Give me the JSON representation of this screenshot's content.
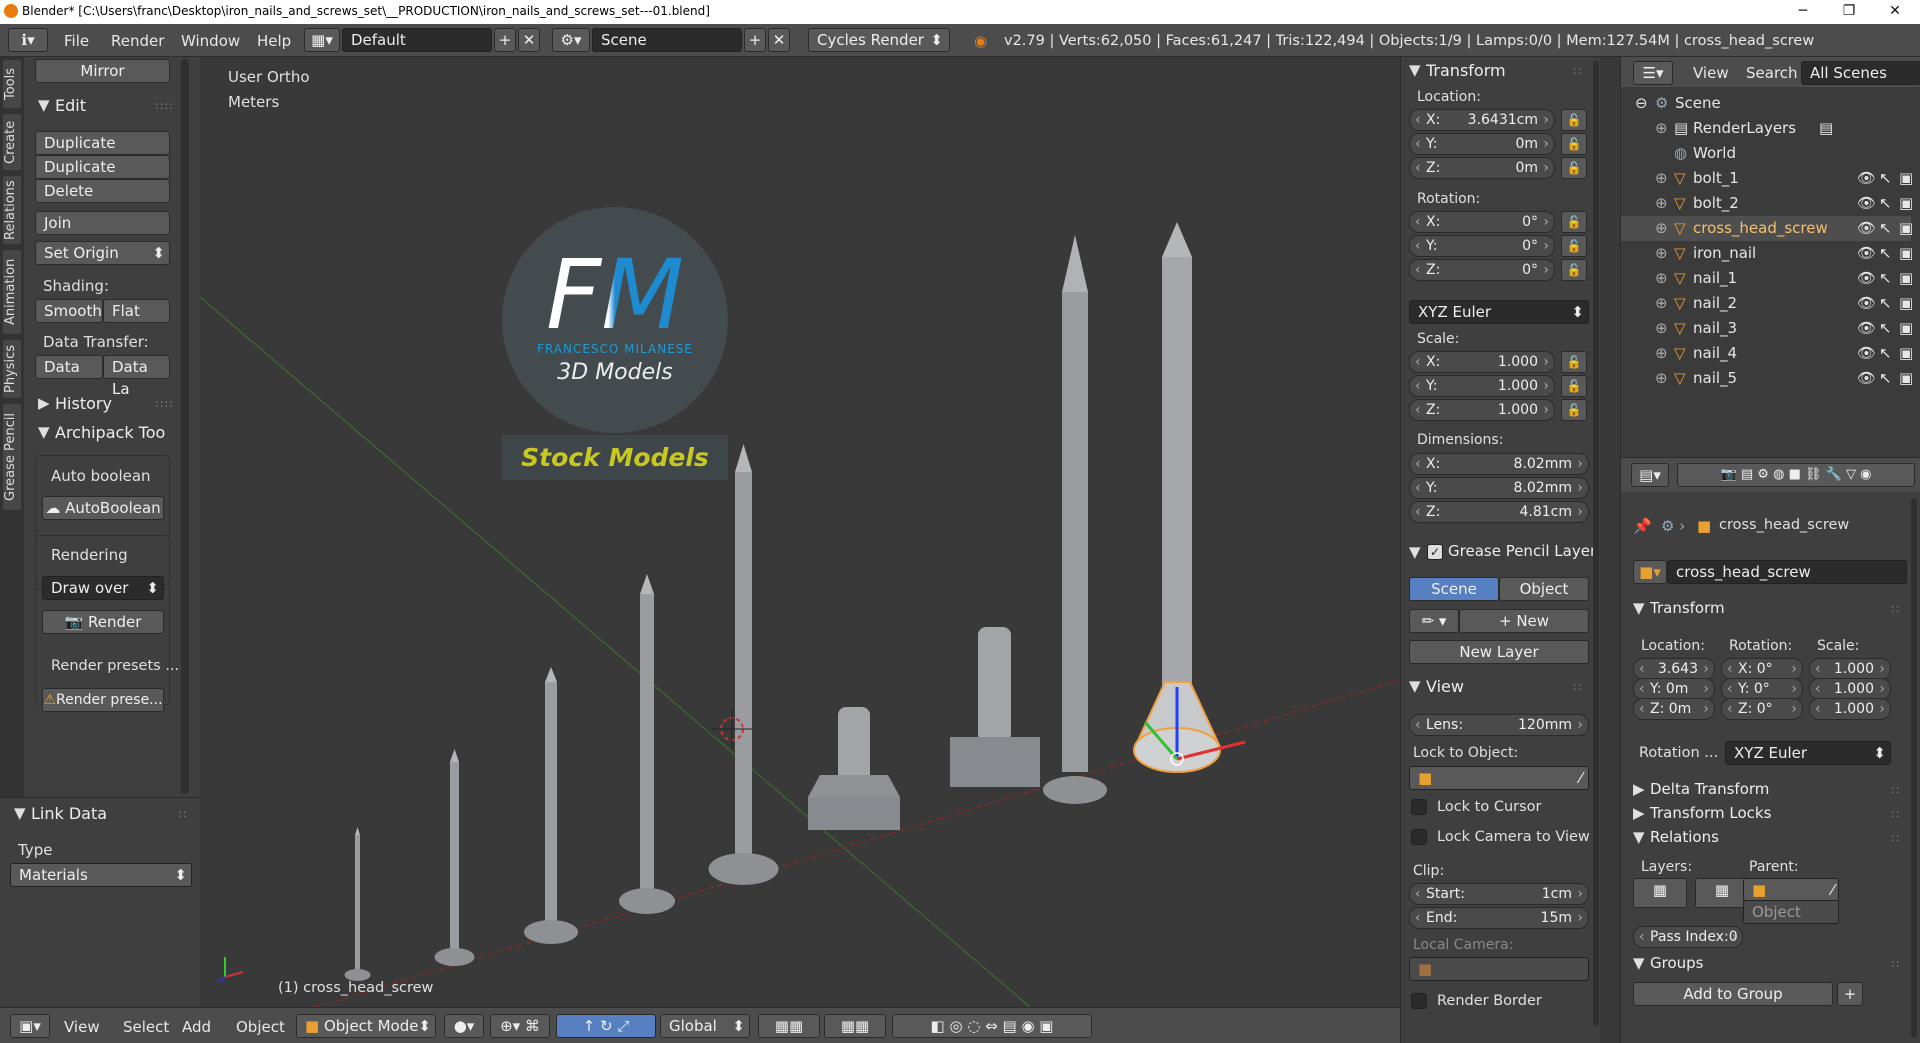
{
  "window": {
    "title": "Blender* [C:\\Users\\franc\\Desktop\\iron_nails_and_screws_set\\__PRODUCTION\\iron_nails_and_screws_set---01.blend]",
    "min": "─",
    "max": "❐",
    "close": "✕"
  },
  "topbar": {
    "menus": [
      "File",
      "Render",
      "Window",
      "Help"
    ],
    "layout": "Default",
    "scene": "Scene",
    "engine": "Cycles Render",
    "stats": "v2.79 | Verts:62,050 | Faces:61,247 | Tris:122,494 | Objects:1/9 | Lamps:0/0 | Mem:127.54M | cross_head_screw"
  },
  "tools": {
    "tabs": [
      "Tools",
      "Create",
      "Relations",
      "Animation",
      "Physics",
      "Grease Pencil"
    ],
    "mirror": "Mirror",
    "edit_title": "Edit",
    "duplicate": "Duplicate",
    "duplicate_linked": "Duplicate Linked",
    "delete": "Delete",
    "join": "Join",
    "set_origin": "Set Origin",
    "shading": "Shading:",
    "smooth": "Smooth",
    "flat": "Flat",
    "data_transfer": "Data Transfer:",
    "data": "Data",
    "data_la": "Data La",
    "history": "History",
    "archipack": "Archipack Too",
    "auto_boolean_title": "Auto boolean",
    "auto_boolean": "AutoBoolean",
    "rendering": "Rendering",
    "draw_over": "Draw over",
    "render": "Render",
    "render_presets": "Render presets ...",
    "render_prese": "Render prese..."
  },
  "link_data": {
    "title": "Link Data",
    "type_label": "Type",
    "type_value": "Materials"
  },
  "viewport": {
    "view": "User Ortho",
    "units": "Meters",
    "object_label": "(1) cross_head_screw",
    "logo_letters": "FM",
    "logo_name": "FRANCESCO MILANESE",
    "logo_sub": "3D Models",
    "stock": "Stock Models"
  },
  "viewport_header": {
    "view": "View",
    "select": "Select",
    "add": "Add",
    "object": "Object",
    "mode": "Object Mode",
    "orientation": "Global"
  },
  "properties": {
    "transform": "Transform",
    "location": "Location:",
    "loc": [
      {
        "k": "X:",
        "v": "3.6431cm"
      },
      {
        "k": "Y:",
        "v": "0m"
      },
      {
        "k": "Z:",
        "v": "0m"
      }
    ],
    "rotation": "Rotation:",
    "rot": [
      {
        "k": "X:",
        "v": "0°"
      },
      {
        "k": "Y:",
        "v": "0°"
      },
      {
        "k": "Z:",
        "v": "0°"
      }
    ],
    "euler": "XYZ Euler",
    "scale": "Scale:",
    "scl": [
      {
        "k": "X:",
        "v": "1.000"
      },
      {
        "k": "Y:",
        "v": "1.000"
      },
      {
        "k": "Z:",
        "v": "1.000"
      }
    ],
    "dimensions": "Dimensions:",
    "dim": [
      {
        "k": "X:",
        "v": "8.02mm"
      },
      {
        "k": "Y:",
        "v": "8.02mm"
      },
      {
        "k": "Z:",
        "v": "4.81cm"
      }
    ],
    "gp_layer": "Grease Pencil Layer",
    "scene": "Scene",
    "object": "Object",
    "new": "New",
    "new_layer": "New Layer",
    "view": "View",
    "lens_k": "Lens:",
    "lens_v": "120mm",
    "lock_to_object": "Lock to Object:",
    "lock_cursor": "Lock to Cursor",
    "lock_camera": "Lock Camera to View",
    "clip": "Clip:",
    "start_k": "Start:",
    "start_v": "1cm",
    "end_k": "End:",
    "end_v": "15m",
    "local_camera": "Local Camera:",
    "render_border": "Render Border"
  },
  "outliner": {
    "view": "View",
    "search": "Search",
    "all_scenes": "All Scenes",
    "scene": "Scene",
    "items": [
      "RenderLayers",
      "World",
      "bolt_1",
      "bolt_2",
      "cross_head_screw",
      "iron_nail",
      "nail_1",
      "nail_2",
      "nail_3",
      "nail_4",
      "nail_5"
    ]
  },
  "objprops": {
    "name_crumb": "cross_head_screw",
    "name": "cross_head_screw",
    "transform": "Transform",
    "location": "Location:",
    "rotation": "Rotation:",
    "scale": "Scale:",
    "loc": [
      "3.643",
      "Y: 0m",
      "Z: 0m"
    ],
    "rot": [
      "X: 0°",
      "Y: 0°",
      "Z: 0°"
    ],
    "scl": [
      "1.000",
      "1.000",
      "1.000"
    ],
    "rot_label": "Rotation ...",
    "rot_mode": "XYZ Euler",
    "delta": "Delta Transform",
    "locks": "Transform Locks",
    "relations": "Relations",
    "layers": "Layers:",
    "parent": "Parent:",
    "parent_type": "Object",
    "pass_index": "Pass Index:0",
    "groups": "Groups",
    "add_to_group": "Add to Group"
  }
}
